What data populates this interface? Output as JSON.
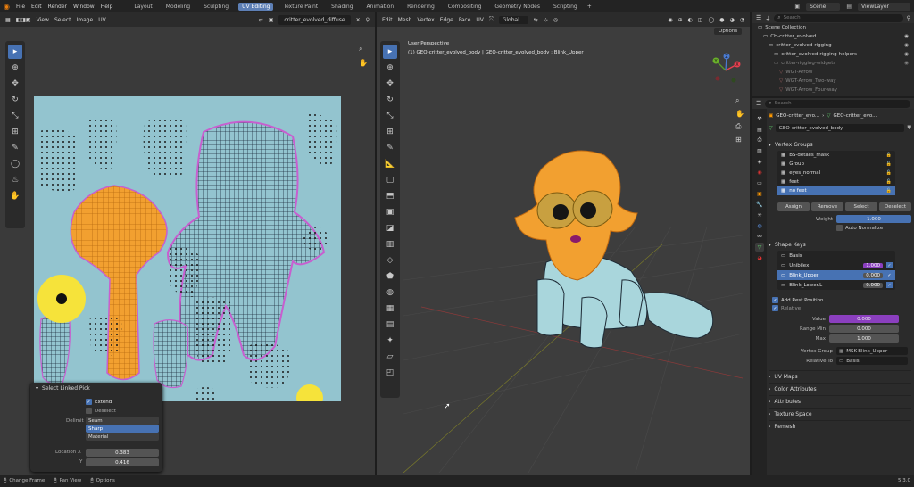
{
  "topbar": {
    "menus": [
      "File",
      "Edit",
      "Render",
      "Window",
      "Help"
    ],
    "workspaces": [
      "Layout",
      "Modeling",
      "Sculpting",
      "UV Editing",
      "Texture Paint",
      "Shading",
      "Animation",
      "Rendering",
      "Compositing",
      "Geometry Nodes",
      "Scripting"
    ],
    "active_workspace": "UV Editing",
    "scene_label": "Scene",
    "viewlayer_label": "ViewLayer"
  },
  "uv_editor": {
    "menus": [
      "View",
      "Select",
      "Image",
      "UV"
    ],
    "image_name": "critter_evolved_diffuse"
  },
  "viewport": {
    "menus": [
      "Edit",
      "Mesh",
      "Vertex",
      "Edge",
      "Face",
      "UV"
    ],
    "transform_orientation": "Global",
    "options_label": "Options",
    "view_name": "User Perspective",
    "object_info": "(1) GEO-critter_evolved_body | GEO-critter_evolved_body : Blink_Upper",
    "axes": {
      "x": "X",
      "y": "Y",
      "z": "Z"
    }
  },
  "operator_panel": {
    "title": "Select Linked Pick",
    "extend_label": "Extend",
    "extend_checked": true,
    "deselect_label": "Deselect",
    "deselect_checked": false,
    "delimit_label": "Delimit",
    "delimit_options": [
      "Seam",
      "Sharp",
      "Material"
    ],
    "delimit_selected": "Sharp",
    "location_x_label": "Location X",
    "location_x": "0.383",
    "location_y_label": "Y",
    "location_y": "0.416"
  },
  "outliner": {
    "search_placeholder": "Search",
    "items": [
      {
        "label": "Scene Collection",
        "depth": 0
      },
      {
        "label": "CH-critter_evolved",
        "depth": 1
      },
      {
        "label": "critter_evolved-rigging",
        "depth": 2
      },
      {
        "label": "critter_evolved-rigging-helpers",
        "depth": 3
      },
      {
        "label": "critter-rigging-widgets",
        "depth": 3
      },
      {
        "label": "WGT-Arrow",
        "depth": 4
      },
      {
        "label": "WGT-Arrow_Two-way",
        "depth": 4
      },
      {
        "label": "WGT-Arrow_Four-way",
        "depth": 4
      }
    ]
  },
  "properties": {
    "search_placeholder": "Search",
    "breadcrumb": [
      "GEO-critter_evo...",
      "GEO-critter_evo..."
    ],
    "mesh_name": "GEO-critter_evolved_body",
    "vertex_groups_title": "Vertex Groups",
    "vertex_groups": [
      "BS-details_mask",
      "Group",
      "eyes_normal",
      "feet",
      "no feet"
    ],
    "vertex_group_selected": "no feet",
    "vg_buttons": [
      "Assign",
      "Remove",
      "Select",
      "Deselect"
    ],
    "weight_label": "Weight",
    "weight_value": "1.000",
    "auto_normalize_label": "Auto Normalize",
    "shape_keys_title": "Shape Keys",
    "shape_keys": [
      {
        "name": "Basis",
        "value": ""
      },
      {
        "name": "Unibilex",
        "value": "1.000"
      },
      {
        "name": "Blink_Upper",
        "value": "0.000"
      },
      {
        "name": "Blink_Lower.L",
        "value": "0.000"
      }
    ],
    "shape_key_selected": "Blink_Upper",
    "add_rest_label": "Add Rest Position",
    "relative_label": "Relative",
    "value_label": "Value",
    "value": "0.000",
    "range_min_label": "Range Min",
    "range_min": "0.000",
    "max_label": "Max",
    "max": "1.000",
    "vertex_group_label": "Vertex Group",
    "vertex_group_value": "MSK-Blink_Upper",
    "relative_to_label": "Relative To",
    "relative_to_value": "Basis",
    "collapsed_panels": [
      "UV Maps",
      "Color Attributes",
      "Attributes",
      "Texture Space",
      "Remesh"
    ]
  },
  "statusbar": {
    "items": [
      "Change Frame",
      "Pan View",
      "Options"
    ],
    "version": "5.3.0"
  },
  "colors": {
    "accent": "#4772b3",
    "uv_bg": "#93c4cf",
    "selected_mesh": "#f2a030",
    "value_purple": "#8b3fbf"
  }
}
